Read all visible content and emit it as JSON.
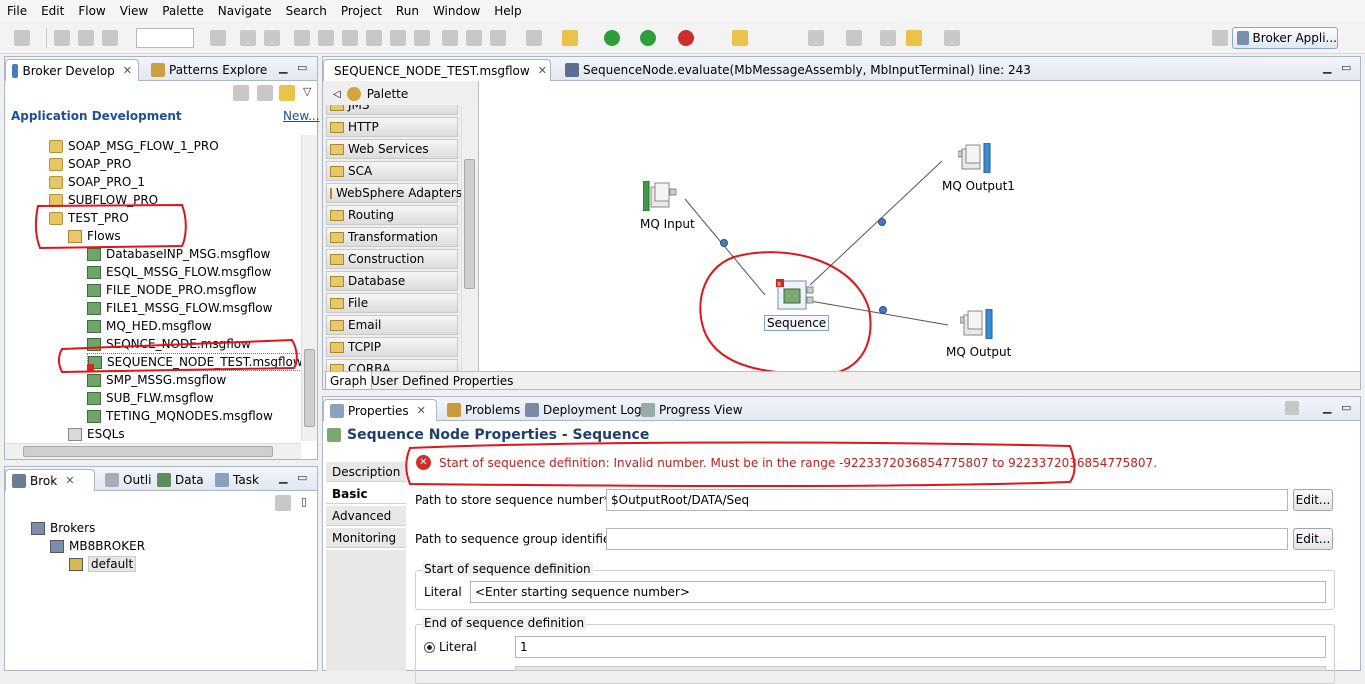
{
  "menu": [
    "File",
    "Edit",
    "Flow",
    "View",
    "Palette",
    "Navigate",
    "Search",
    "Project",
    "Run",
    "Window",
    "Help"
  ],
  "toolbar": {
    "perspective_label": "Broker Appli..."
  },
  "left_top": {
    "tabs": [
      {
        "label": "Broker Develop",
        "active": true
      },
      {
        "label": "Patterns Explore",
        "active": false
      }
    ],
    "section_title": "Application Development",
    "new_link": "New...",
    "tree": [
      {
        "label": "SOAP_MSG_FLOW_1_PRO",
        "kind": "proj",
        "indent": 0
      },
      {
        "label": "SOAP_PRO",
        "kind": "proj",
        "indent": 0
      },
      {
        "label": "SOAP_PRO_1",
        "kind": "proj",
        "indent": 0
      },
      {
        "label": "SUBFLOW_PRO",
        "kind": "proj",
        "indent": 0
      },
      {
        "label": "TEST_PRO",
        "kind": "projerr",
        "indent": 0
      },
      {
        "label": "Flows",
        "kind": "folder",
        "indent": 1
      },
      {
        "label": "DatabaseINP_MSG.msgflow",
        "kind": "flow",
        "indent": 2
      },
      {
        "label": "ESQL_MSSG_FLOW.msgflow",
        "kind": "flow",
        "indent": 2
      },
      {
        "label": "FILE_NODE_PRO.msgflow",
        "kind": "flow",
        "indent": 2
      },
      {
        "label": "FILE1_MSSG_FLOW.msgflow",
        "kind": "flow",
        "indent": 2
      },
      {
        "label": "MQ_HED.msgflow",
        "kind": "flow",
        "indent": 2
      },
      {
        "label": "SEQNCE_NODE.msgflow",
        "kind": "flow",
        "indent": 2
      },
      {
        "label": "SEQUENCE_NODE_TEST.msgflow",
        "kind": "flowerr",
        "indent": 2
      },
      {
        "label": "SMP_MSSG.msgflow",
        "kind": "flow",
        "indent": 2
      },
      {
        "label": "SUB_FLW.msgflow",
        "kind": "flow",
        "indent": 2
      },
      {
        "label": "TETING_MQNODES.msgflow",
        "kind": "flow",
        "indent": 2
      },
      {
        "label": "ESQLs",
        "kind": "esql",
        "indent": 1
      }
    ]
  },
  "left_bottom": {
    "tabs": [
      {
        "label": "Brok",
        "active": true
      },
      {
        "label": "Outli",
        "active": false
      },
      {
        "label": "Data",
        "active": false
      },
      {
        "label": "Task",
        "active": false
      }
    ],
    "tree": [
      {
        "label": "Brokers",
        "indent": 0
      },
      {
        "label": "MB8BROKER",
        "indent": 1
      },
      {
        "label": "default",
        "indent": 2
      }
    ]
  },
  "editor": {
    "tabs": [
      {
        "label": "SEQUENCE_NODE_TEST.msgflow",
        "active": true
      },
      {
        "label": "SequenceNode.evaluate(MbMessageAssembly, MbInputTerminal) line: 243",
        "active": false
      }
    ],
    "palette_title": "Palette",
    "palette_items": [
      "JMS",
      "HTTP",
      "Web Services",
      "SCA",
      "WebSphere Adapters",
      "Routing",
      "Transformation",
      "Construction",
      "Database",
      "File",
      "Email",
      "TCPIP",
      "CORBA"
    ],
    "nodes": {
      "mq_input": "MQ Input",
      "sequence": "Sequence",
      "mq_output1": "MQ Output1",
      "mq_output": "MQ Output"
    },
    "bottom_tabs": [
      "Graph",
      "User Defined Properties"
    ]
  },
  "properties": {
    "tabs": [
      {
        "label": "Properties",
        "active": true
      },
      {
        "label": "Problems",
        "active": false
      },
      {
        "label": "Deployment Log",
        "active": false
      },
      {
        "label": "Progress View",
        "active": false
      }
    ],
    "title": "Sequence Node Properties - Sequence",
    "error": "Start of sequence definition: Invalid number. Must be in the range -9223372036854775807 to 9223372036854775807.",
    "side_tabs": [
      "Description",
      "Basic",
      "Advanced",
      "Monitoring"
    ],
    "selected_side_tab": "Basic",
    "fields": {
      "seq_number_label": "Path to store sequence number*",
      "seq_number_value": "$OutputRoot/DATA/Seq",
      "group_id_label": "Path to sequence group identifier",
      "group_id_value": "",
      "edit_label": "Edit...",
      "start_group_title": "Start of sequence definition",
      "literal_label": "Literal",
      "start_literal_value": "<Enter starting sequence number>",
      "end_group_title": "End of sequence definition",
      "end_literal_value": "1"
    }
  }
}
